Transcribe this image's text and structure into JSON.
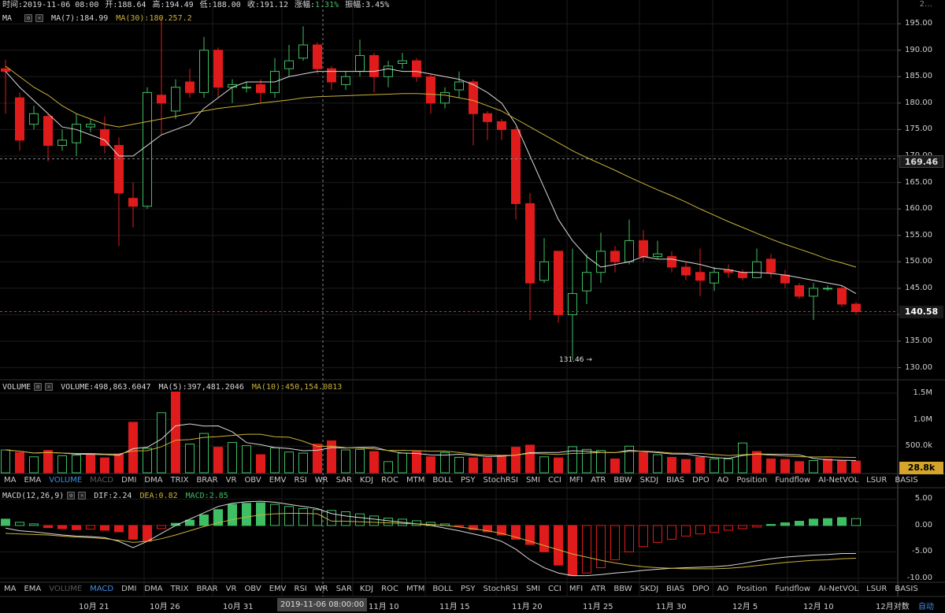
{
  "header": {
    "time_label": "时间:2019-11-06 08:00",
    "open_label": "开:188.64",
    "high_label": "高:194.49",
    "low_label": "低:188.00",
    "close_label": "收:191.12",
    "change_label": "涨幅:",
    "change_value": "1.31%",
    "amplitude_label": "振幅:3.45%"
  },
  "main_panel": {
    "name": "MA",
    "ma7": "MA(7):184.99",
    "ma30": "MA(30):180.257.2",
    "y_ticks": [
      "195.00",
      "190.00",
      "185.00",
      "180.00",
      "175.00",
      "170.00",
      "165.00",
      "160.00",
      "155.00",
      "150.00",
      "145.00",
      "140.00",
      "135.00",
      "130.00"
    ],
    "cursor_price": "169.46",
    "last_price": "140.58",
    "low_annotation": "131.46 →",
    "top_cut_label": "2…"
  },
  "volume_panel": {
    "name": "VOLUME",
    "volume": "VOLUME:498,863.6047",
    "ma5": "MA(5):397,481.2046",
    "ma10": "MA(10):450,154.0813",
    "y_ticks": [
      "1.5M",
      "1.0M",
      "500.0k"
    ],
    "last_volume": "28.8k"
  },
  "macd_panel": {
    "name": "MACD(12,26,9)",
    "dif": "DIF:2.24",
    "dea": "DEA:0.82",
    "macd": "MACD:2.85",
    "y_ticks": [
      "5.00",
      "0.00",
      "-5.00",
      "-10.00"
    ]
  },
  "indicator_tabs_1": [
    {
      "label": "MA",
      "state": "normal"
    },
    {
      "label": "EMA",
      "state": "normal"
    },
    {
      "label": "VOLUME",
      "state": "active"
    },
    {
      "label": "MACD",
      "state": "dim"
    },
    {
      "label": "DMI",
      "state": "normal"
    },
    {
      "label": "DMA",
      "state": "normal"
    },
    {
      "label": "TRIX",
      "state": "normal"
    },
    {
      "label": "BRAR",
      "state": "normal"
    },
    {
      "label": "VR",
      "state": "normal"
    },
    {
      "label": "OBV",
      "state": "normal"
    },
    {
      "label": "EMV",
      "state": "normal"
    },
    {
      "label": "RSI",
      "state": "normal"
    },
    {
      "label": "WR",
      "state": "normal"
    },
    {
      "label": "SAR",
      "state": "normal"
    },
    {
      "label": "KDJ",
      "state": "normal"
    },
    {
      "label": "ROC",
      "state": "normal"
    },
    {
      "label": "MTM",
      "state": "normal"
    },
    {
      "label": "BOLL",
      "state": "normal"
    },
    {
      "label": "PSY",
      "state": "normal"
    },
    {
      "label": "StochRSI",
      "state": "normal"
    },
    {
      "label": "SMI",
      "state": "normal"
    },
    {
      "label": "CCI",
      "state": "normal"
    },
    {
      "label": "MFI",
      "state": "normal"
    },
    {
      "label": "ATR",
      "state": "normal"
    },
    {
      "label": "BBW",
      "state": "normal"
    },
    {
      "label": "SKDJ",
      "state": "normal"
    },
    {
      "label": "BIAS",
      "state": "normal"
    },
    {
      "label": "DPO",
      "state": "normal"
    },
    {
      "label": "AO",
      "state": "normal"
    },
    {
      "label": "Position",
      "state": "normal"
    },
    {
      "label": "Fundflow",
      "state": "normal"
    },
    {
      "label": "AI-NetVOL",
      "state": "normal"
    },
    {
      "label": "LSUR",
      "state": "normal"
    },
    {
      "label": "BASIS",
      "state": "normal"
    }
  ],
  "indicator_tabs_2": [
    {
      "label": "MA",
      "state": "normal"
    },
    {
      "label": "EMA",
      "state": "normal"
    },
    {
      "label": "VOLUME",
      "state": "dim"
    },
    {
      "label": "MACD",
      "state": "active"
    },
    {
      "label": "DMI",
      "state": "normal"
    },
    {
      "label": "DMA",
      "state": "normal"
    },
    {
      "label": "TRIX",
      "state": "normal"
    },
    {
      "label": "BRAR",
      "state": "normal"
    },
    {
      "label": "VR",
      "state": "normal"
    },
    {
      "label": "OBV",
      "state": "normal"
    },
    {
      "label": "EMV",
      "state": "normal"
    },
    {
      "label": "RSI",
      "state": "normal"
    },
    {
      "label": "WR",
      "state": "normal"
    },
    {
      "label": "SAR",
      "state": "normal"
    },
    {
      "label": "KDJ",
      "state": "normal"
    },
    {
      "label": "ROC",
      "state": "normal"
    },
    {
      "label": "MTM",
      "state": "normal"
    },
    {
      "label": "BOLL",
      "state": "normal"
    },
    {
      "label": "PSY",
      "state": "normal"
    },
    {
      "label": "StochRSI",
      "state": "normal"
    },
    {
      "label": "SMI",
      "state": "normal"
    },
    {
      "label": "CCI",
      "state": "normal"
    },
    {
      "label": "MFI",
      "state": "normal"
    },
    {
      "label": "ATR",
      "state": "normal"
    },
    {
      "label": "BBW",
      "state": "normal"
    },
    {
      "label": "SKDJ",
      "state": "normal"
    },
    {
      "label": "BIAS",
      "state": "normal"
    },
    {
      "label": "DPO",
      "state": "normal"
    },
    {
      "label": "AO",
      "state": "normal"
    },
    {
      "label": "Position",
      "state": "normal"
    },
    {
      "label": "Fundflow",
      "state": "normal"
    },
    {
      "label": "AI-NetVOL",
      "state": "normal"
    },
    {
      "label": "LSUR",
      "state": "normal"
    },
    {
      "label": "BASIS",
      "state": "normal"
    }
  ],
  "x_axis": {
    "labels": [
      "10月 21",
      "10月 26",
      "10月 31",
      "11月 10",
      "11月 15",
      "11月 20",
      "11月 25",
      "11月 30",
      "12月 5",
      "12月 10",
      "12月对数"
    ],
    "cursor_time": "2019-11-06 08:00:00",
    "auto_label": "自动"
  },
  "colors": {
    "up": "#3fbf63",
    "down": "#e01b1b",
    "ma7": "#d9d9d9",
    "ma30": "#c9b23a",
    "background": "#000000",
    "grid": "#1c1c1c",
    "change": "#3fbf63"
  },
  "chart_data": {
    "type": "candlestick",
    "y_range": [
      128,
      198
    ],
    "candles": [
      [
        186.5,
        186.0,
        188.2,
        178.0
      ],
      [
        181.0,
        173.0,
        182.0,
        171.0
      ],
      [
        176.0,
        178.0,
        179.5,
        175.0
      ],
      [
        177.5,
        172.0,
        178.0,
        169.0
      ],
      [
        172.0,
        173.0,
        175.0,
        171.0
      ],
      [
        172.5,
        176.0,
        178.0,
        170.0
      ],
      [
        175.5,
        176.0,
        177.0,
        174.5
      ],
      [
        175.0,
        172.0,
        177.5,
        170.5
      ],
      [
        172.0,
        163.0,
        173.5,
        153.0
      ],
      [
        162.0,
        160.5,
        165.0,
        156.5
      ],
      [
        160.5,
        182.0,
        183.0,
        160.0
      ],
      [
        181.5,
        180.0,
        196.0,
        174.0
      ],
      [
        178.5,
        183.0,
        184.5,
        177.0
      ],
      [
        184.0,
        182.0,
        186.5,
        181.0
      ],
      [
        182.0,
        190.0,
        192.5,
        181.0
      ],
      [
        190.0,
        183.0,
        190.5,
        181.0
      ],
      [
        183.0,
        183.5,
        184.5,
        180.0
      ],
      [
        183.0,
        183.0,
        184.0,
        182.0
      ],
      [
        183.5,
        182.0,
        184.5,
        180.0
      ],
      [
        182.0,
        186.0,
        188.5,
        181.0
      ],
      [
        186.5,
        188.0,
        191.0,
        185.0
      ],
      [
        188.5,
        191.0,
        194.5,
        188.0
      ],
      [
        191.0,
        186.5,
        191.5,
        185.5
      ],
      [
        186.5,
        184.0,
        187.0,
        182.5
      ],
      [
        183.5,
        185.0,
        186.0,
        182.5
      ],
      [
        186.0,
        189.0,
        192.0,
        185.0
      ],
      [
        189.0,
        185.0,
        189.5,
        182.0
      ],
      [
        185.0,
        187.0,
        188.0,
        183.0
      ],
      [
        187.5,
        188.0,
        189.5,
        186.5
      ],
      [
        188.0,
        185.0,
        188.5,
        184.0
      ],
      [
        185.0,
        180.0,
        185.5,
        178.0
      ],
      [
        180.0,
        182.0,
        183.0,
        179.0
      ],
      [
        182.5,
        184.0,
        186.0,
        181.0
      ],
      [
        184.0,
        178.0,
        184.5,
        172.0
      ],
      [
        178.0,
        176.5,
        178.5,
        173.0
      ],
      [
        176.5,
        175.0,
        177.0,
        173.0
      ],
      [
        175.0,
        161.0,
        175.5,
        158.0
      ],
      [
        161.0,
        146.0,
        163.0,
        139.0
      ],
      [
        146.5,
        150.0,
        154.5,
        146.0
      ],
      [
        152.0,
        140.0,
        152.0,
        138.5
      ],
      [
        140.0,
        144.0,
        152.5,
        131.46
      ],
      [
        144.5,
        148.0,
        151.5,
        142.0
      ],
      [
        148.0,
        152.0,
        155.5,
        146.0
      ],
      [
        152.0,
        150.0,
        153.0,
        148.0
      ],
      [
        150.0,
        154.0,
        158.0,
        149.5
      ],
      [
        154.0,
        151.0,
        156.0,
        150.0
      ],
      [
        151.0,
        151.5,
        154.0,
        150.5
      ],
      [
        151.0,
        149.0,
        152.0,
        148.0
      ],
      [
        149.0,
        147.5,
        150.0,
        146.5
      ],
      [
        148.0,
        146.5,
        152.5,
        143.5
      ],
      [
        146.0,
        148.0,
        149.0,
        144.5
      ],
      [
        148.5,
        148.0,
        149.5,
        147.0
      ],
      [
        148.0,
        147.0,
        148.5,
        146.5
      ],
      [
        147.0,
        150.0,
        152.5,
        147.0
      ],
      [
        150.5,
        148.0,
        151.5,
        147.0
      ],
      [
        147.5,
        146.0,
        148.5,
        145.0
      ],
      [
        145.5,
        143.5,
        146.0,
        143.0
      ],
      [
        143.5,
        145.0,
        146.0,
        139.0
      ],
      [
        145.0,
        145.0,
        145.5,
        144.5
      ],
      [
        145.0,
        142.0,
        145.5,
        141.5
      ],
      [
        142.0,
        140.58,
        142.5,
        140.0
      ]
    ],
    "ma7": [
      186,
      183,
      180.5,
      178,
      175.5,
      175,
      174,
      173,
      170,
      170,
      172,
      174,
      175,
      176,
      179,
      181,
      183,
      184,
      184,
      184,
      185,
      185.5,
      186,
      186,
      186,
      186,
      186,
      186.5,
      186,
      186,
      185.5,
      185,
      184.5,
      183.5,
      182,
      180,
      176,
      170,
      164,
      158,
      154,
      151,
      149,
      149.5,
      150,
      151,
      150.5,
      150.5,
      150,
      149.5,
      148.8,
      148.5,
      148,
      148,
      147.8,
      147.5,
      147,
      146.5,
      146,
      145.5,
      144
    ],
    "ma30": [
      187,
      185,
      183,
      181.5,
      179.5,
      178,
      177,
      176,
      175.5,
      176,
      176.5,
      177,
      177.5,
      178,
      178.5,
      179,
      179.3,
      179.6,
      180,
      180.3,
      180.6,
      181,
      181.2,
      181.3,
      181.4,
      181.5,
      181.6,
      181.7,
      181.8,
      181.8,
      181.7,
      181.5,
      181,
      180.5,
      179.5,
      178.5,
      177,
      175.5,
      174,
      172.5,
      171,
      169.7,
      168.5,
      167.3,
      166,
      164.8,
      163.6,
      162.5,
      161.3,
      160,
      158.8,
      157.6,
      156.5,
      155.4,
      154.3,
      153.3,
      152.4,
      151.5,
      150.5,
      149.8,
      149
    ],
    "volume": [
      430,
      380,
      300,
      420,
      320,
      330,
      360,
      280,
      350,
      950,
      460,
      1130,
      1520,
      540,
      740,
      480,
      570,
      510,
      340,
      470,
      390,
      370,
      540,
      600,
      430,
      440,
      400,
      210,
      370,
      400,
      300,
      380,
      290,
      280,
      280,
      330,
      480,
      520,
      300,
      280,
      490,
      440,
      420,
      260,
      500,
      380,
      340,
      290,
      250,
      290,
      260,
      260,
      560,
      400,
      260,
      250,
      210,
      230,
      260,
      230,
      220
    ],
    "volume_scaled_up": [
      true,
      false,
      true,
      false,
      true,
      true,
      false,
      false,
      false,
      false,
      true,
      true,
      false,
      true,
      true,
      false,
      true,
      true,
      false,
      true,
      true,
      true,
      false,
      false,
      true,
      true,
      false,
      true,
      true,
      false,
      false,
      true,
      true,
      false,
      false,
      false,
      false,
      false,
      true,
      false,
      true,
      true,
      true,
      false,
      true,
      false,
      true,
      false,
      false,
      false,
      true,
      true,
      true,
      false,
      false,
      false,
      false,
      true,
      false,
      false,
      false
    ],
    "macd_hist": [
      1.2,
      0.6,
      0.3,
      -0.4,
      -0.6,
      -0.8,
      -0.7,
      -0.9,
      -1.2,
      -2.6,
      -3.0,
      -0.6,
      0.4,
      1.0,
      2.0,
      3.0,
      4.0,
      4.2,
      4.3,
      4.0,
      3.6,
      3.2,
      3.0,
      2.85,
      2.6,
      2.2,
      1.8,
      1.4,
      1.2,
      0.9,
      0.6,
      0.3,
      -0.2,
      -0.8,
      -1.2,
      -1.8,
      -2.6,
      -3.6,
      -5.0,
      -7.5,
      -9.5,
      -9.0,
      -8.0,
      -6.5,
      -5.0,
      -4.0,
      -3.2,
      -2.6,
      -2.0,
      -1.6,
      -1.3,
      -0.9,
      -0.6,
      -0.3,
      0.2,
      0.5,
      0.8,
      1.2,
      1.3,
      1.5,
      1.3
    ],
    "dif": [
      -0.5,
      -1.0,
      -1.2,
      -1.5,
      -1.8,
      -2.0,
      -2.1,
      -2.3,
      -3.0,
      -4.2,
      -3.0,
      -1.5,
      0.0,
      1.2,
      2.4,
      3.6,
      4.2,
      4.5,
      4.6,
      4.4,
      4.0,
      3.6,
      3.2,
      2.24,
      1.8,
      1.5,
      1.2,
      0.9,
      0.6,
      0.3,
      0.0,
      -0.5,
      -1.0,
      -1.6,
      -2.2,
      -3.0,
      -4.5,
      -6.5,
      -8.0,
      -9.0,
      -9.5,
      -9.5,
      -9.3,
      -9.0,
      -8.8,
      -8.5,
      -8.3,
      -8.1,
      -8.0,
      -7.9,
      -7.8,
      -7.6,
      -7.2,
      -6.7,
      -6.3,
      -6.0,
      -5.8,
      -5.6,
      -5.5,
      -5.3,
      -5.3
    ],
    "dea": [
      -1.5,
      -1.6,
      -1.7,
      -1.8,
      -2.0,
      -2.2,
      -2.3,
      -2.5,
      -2.8,
      -3.2,
      -3.0,
      -2.5,
      -1.8,
      -1.0,
      -0.2,
      0.5,
      1.1,
      1.6,
      2.0,
      2.2,
      2.3,
      2.3,
      2.2,
      0.82,
      0.8,
      0.7,
      0.6,
      0.5,
      0.4,
      0.3,
      0.2,
      0.0,
      -0.3,
      -0.6,
      -1.0,
      -1.5,
      -2.2,
      -3.0,
      -3.8,
      -4.6,
      -5.4,
      -6.0,
      -6.6,
      -7.1,
      -7.5,
      -7.8,
      -8.0,
      -8.1,
      -8.2,
      -8.2,
      -8.2,
      -8.1,
      -7.9,
      -7.6,
      -7.3,
      -7.0,
      -6.8,
      -6.6,
      -6.5,
      -6.3,
      -6.2
    ]
  }
}
